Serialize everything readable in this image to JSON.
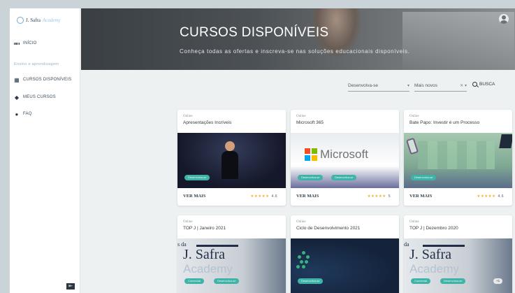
{
  "sidebar": {
    "logo": {
      "brand": "J. Safra",
      "suffix": "Academy"
    },
    "home_label": "INÍCIO",
    "section_label": "Ensino e aprendizagem",
    "items": [
      {
        "label": "CURSOS DISPONÍVEIS"
      },
      {
        "label": "MEUS CURSOS"
      },
      {
        "label": "FAQ"
      }
    ],
    "collapse_glyph": "⇤"
  },
  "hero": {
    "title": "CURSOS DISPONÍVEIS",
    "subtitle": "Conheça todas as ofertas e inscreva-se nas soluções educacionais disponíveis."
  },
  "filters": {
    "filter1": "Desenvolva-se",
    "filter2": "Mais novos",
    "search_label": "BUSCA"
  },
  "cards": [
    {
      "category": "Online",
      "title": "Apresentações Incríveis",
      "more": "VER MAIS",
      "stars": "★★★★★",
      "rating": "4.6",
      "tags": [
        "Desenvolva-se"
      ]
    },
    {
      "category": "Online",
      "title": "Microsoft 365",
      "more": "VER MAIS",
      "stars": "★★★★★",
      "rating": "5",
      "thumb_text": "Microsoft",
      "tags": [
        "Desenvolva-se",
        "Desenvolva-se"
      ]
    },
    {
      "category": "Online",
      "title": "Bate Papo: Investir é um Processo",
      "more": "VER MAIS",
      "stars": "★★★★★",
      "rating": "4.6",
      "tags": [
        "Desenvolva-se"
      ]
    },
    {
      "category": "Online",
      "title": "TOP J | Janeiro 2021",
      "thumb_brand": "J. Safra",
      "thumb_brand2": "Academy",
      "thumb_da": "s da",
      "tags": [
        "Comercial",
        "Desenvolva-se"
      ]
    },
    {
      "category": "Online",
      "title": "Ciclo de Desenvolvimento 2021",
      "tags": [
        "Desenvolva-se"
      ]
    },
    {
      "category": "Online",
      "title": "TOP J | Dezembro 2020",
      "thumb_brand": "J. Safra",
      "thumb_brand2": "Academy",
      "thumb_da": "da",
      "tags": [
        "Comercial",
        "Desenvolva-se"
      ],
      "extra_count": "+1"
    }
  ],
  "colors": {
    "accent": "#3fb3a7",
    "stars": "#f2b234",
    "microsoft": [
      "#f25022",
      "#7fba00",
      "#00a4ef",
      "#ffb900"
    ]
  }
}
